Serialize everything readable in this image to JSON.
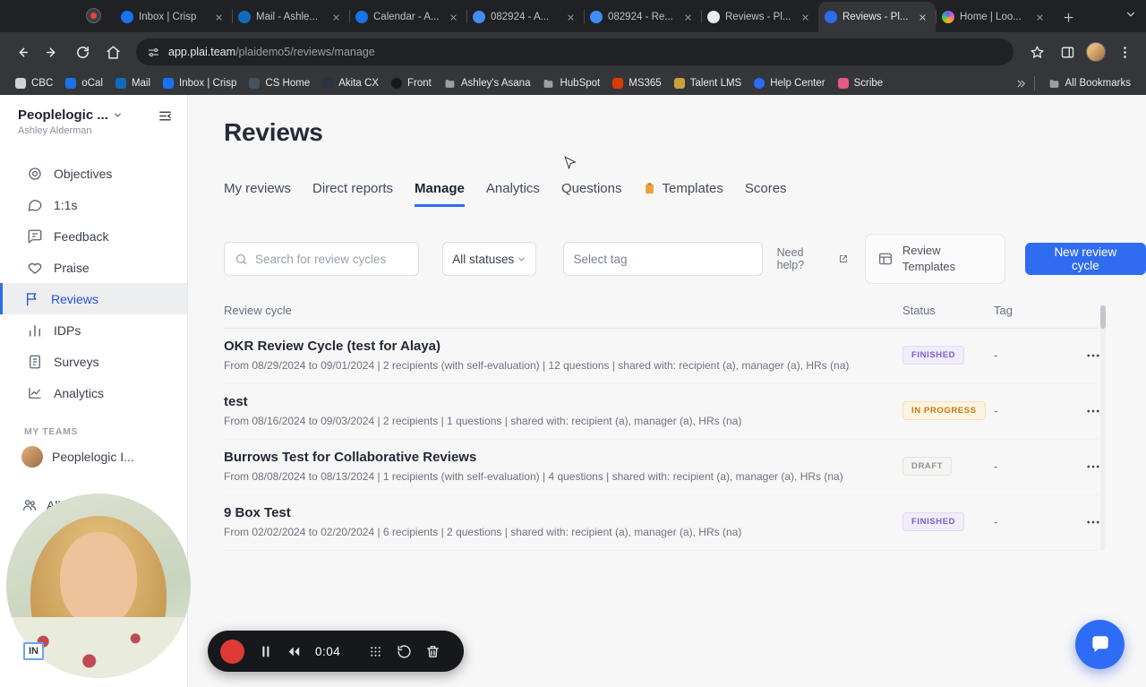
{
  "colors": {
    "accent_blue": "#2f6cf0",
    "chrome_frame": "#202124",
    "chrome_toolbar": "#35363a",
    "status_finished": "#7b5fd0",
    "status_in_progress": "#c07c12",
    "status_draft": "#8b9098",
    "record_red": "#e03a36",
    "chat_bubble_blue": "#2f6cf5"
  },
  "browser": {
    "tabs": [
      {
        "title": "Inbox | Crisp"
      },
      {
        "title": "Mail - Ashle..."
      },
      {
        "title": "Calendar - A..."
      },
      {
        "title": "082924 - A..."
      },
      {
        "title": "082924 - Re..."
      },
      {
        "title": "Reviews - Pl..."
      },
      {
        "title": "Reviews - Pl..."
      },
      {
        "title": "Home | Loo..."
      }
    ],
    "address": {
      "domain": "app.plai.team",
      "path": "/plaidemo5/reviews/manage"
    },
    "bookmarks": [
      {
        "label": "CBC"
      },
      {
        "label": "oCal"
      },
      {
        "label": "Mail"
      },
      {
        "label": "Inbox | Crisp"
      },
      {
        "label": "CS Home"
      },
      {
        "label": "Akita CX"
      },
      {
        "label": "Front"
      },
      {
        "label": "Ashley's Asana"
      },
      {
        "label": "HubSpot"
      },
      {
        "label": "MS365"
      },
      {
        "label": "Talent LMS"
      },
      {
        "label": "Help Center"
      },
      {
        "label": "Scribe"
      }
    ],
    "all_bookmarks_label": "All Bookmarks"
  },
  "sidebar": {
    "workspace_name": "Peoplelogic ...",
    "workspace_user": "Ashley Alderman",
    "nav": [
      {
        "label": "Objectives"
      },
      {
        "label": "1:1s"
      },
      {
        "label": "Feedback"
      },
      {
        "label": "Praise"
      },
      {
        "label": "Reviews"
      },
      {
        "label": "IDPs"
      },
      {
        "label": "Surveys"
      },
      {
        "label": "Analytics"
      }
    ],
    "teams_header": "MY TEAMS",
    "teams": [
      {
        "label": "Peoplelogic I..."
      },
      {
        "label": "All..."
      }
    ]
  },
  "main": {
    "title": "Reviews",
    "tabs": [
      {
        "label": "My reviews"
      },
      {
        "label": "Direct reports"
      },
      {
        "label": "Manage"
      },
      {
        "label": "Analytics"
      },
      {
        "label": "Questions"
      },
      {
        "label": "Templates"
      },
      {
        "label": "Scores"
      }
    ],
    "filters": {
      "search_placeholder": "Search for review cycles",
      "status_value": "All statuses",
      "tag_value": "Select tag",
      "help_label": "Need help?",
      "templates_button_label": "Review Templates",
      "new_cycle_button_label": "New review cycle"
    },
    "table": {
      "columns": [
        "Review cycle",
        "Status",
        "Tag"
      ],
      "rows": [
        {
          "title": "OKR Review Cycle (test for Alaya)",
          "meta": "From 08/29/2024 to 09/01/2024 | 2 recipients (with self-evaluation) | 12 questions | shared with: recipient (a), manager (a), HRs (na)",
          "status": "FINISHED",
          "status_class": "badge badge-finished",
          "tag": "-"
        },
        {
          "title": "test",
          "meta": "From 08/16/2024 to 09/03/2024 | 2 recipients | 1 questions | shared with: recipient (a), manager (a), HRs (na)",
          "status": "IN PROGRESS",
          "status_class": "badge badge-in-progress",
          "tag": "-"
        },
        {
          "title": "Burrows Test for Collaborative Reviews",
          "meta": "From 08/08/2024 to 08/13/2024 | 1 recipients (with self-evaluation) | 4 questions | shared with: recipient (a), manager (a), HRs (na)",
          "status": "DRAFT",
          "status_class": "badge badge-draft",
          "tag": "-"
        },
        {
          "title": "9 Box Test",
          "meta": "From 02/02/2024 to 02/20/2024 | 6 recipients | 2 questions | shared with: recipient (a), manager (a), HRs (na)",
          "status": "FINISHED",
          "status_class": "badge badge-finished",
          "tag": "-"
        }
      ]
    }
  },
  "recorder": {
    "time": "0:04"
  },
  "overlay": {
    "partial_text": "IN"
  }
}
